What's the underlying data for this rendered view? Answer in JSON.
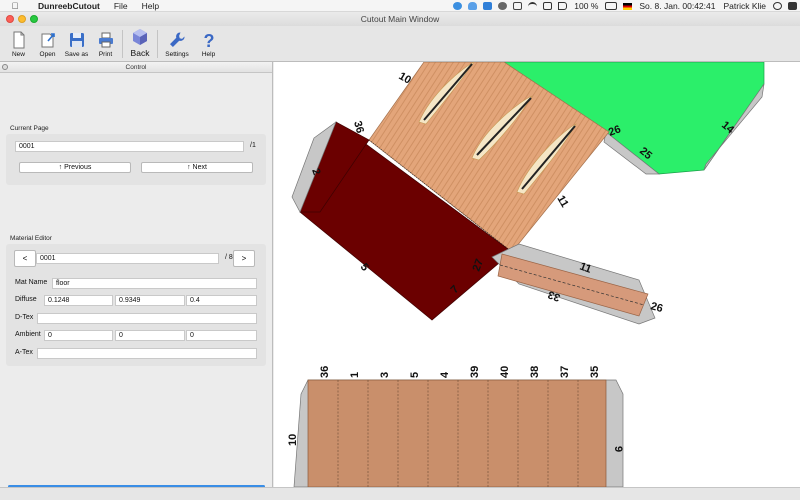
{
  "menubar": {
    "app_name": "DunreebCutout",
    "menu_file": "File",
    "menu_help": "Help",
    "battery": "100 %",
    "clock": "So. 8. Jan.  00:42:41",
    "user": "Patrick Klie"
  },
  "window": {
    "title": "Cutout Main Window"
  },
  "toolbar": {
    "new_label": "New",
    "open_label": "Open",
    "save_as_label": "Save as",
    "print_label": "Print",
    "back_label": "Back",
    "settings_label": "Settings",
    "help_label": "Help"
  },
  "control": {
    "title": "Control",
    "current_page": {
      "label": "Current Page",
      "value": "0001",
      "total": "/1",
      "previous_label": "Previous",
      "next_label": "Next"
    },
    "material_editor": {
      "label": "Material Editor",
      "prev_label": "<",
      "index_value": "0001",
      "total": "/ 8",
      "next_label": ">",
      "mat_name_label": "Mat Name",
      "mat_name_value": "floor",
      "diffuse_label": "Diffuse",
      "diffuse_r": "0.1248",
      "diffuse_g": "0.9349",
      "diffuse_b": "0.4",
      "dtex_label": "D-Tex",
      "dtex_value": "",
      "ambient_label": "Ambient",
      "ambient_r": "0",
      "ambient_g": "0",
      "ambient_b": "0",
      "atex_label": "A-Tex",
      "atex_value": ""
    }
  },
  "canvas_labels": {
    "top_part": [
      "10",
      "36",
      "2",
      "5",
      "7",
      "11",
      "26",
      "25",
      "14",
      "27"
    ],
    "strip_part": [
      "11",
      "33",
      "26"
    ],
    "bottom_part": [
      "36",
      "1",
      "3",
      "5",
      "4",
      "39",
      "40",
      "38",
      "37",
      "35",
      "10",
      "9"
    ]
  },
  "colors": {
    "tan": "#e3a57a",
    "dark_red": "#6b0000",
    "green": "#2bef6a",
    "grey_flap": "#c7c7c7",
    "wood": "#c98f6b",
    "accent_blue": "#3a8ee6"
  }
}
